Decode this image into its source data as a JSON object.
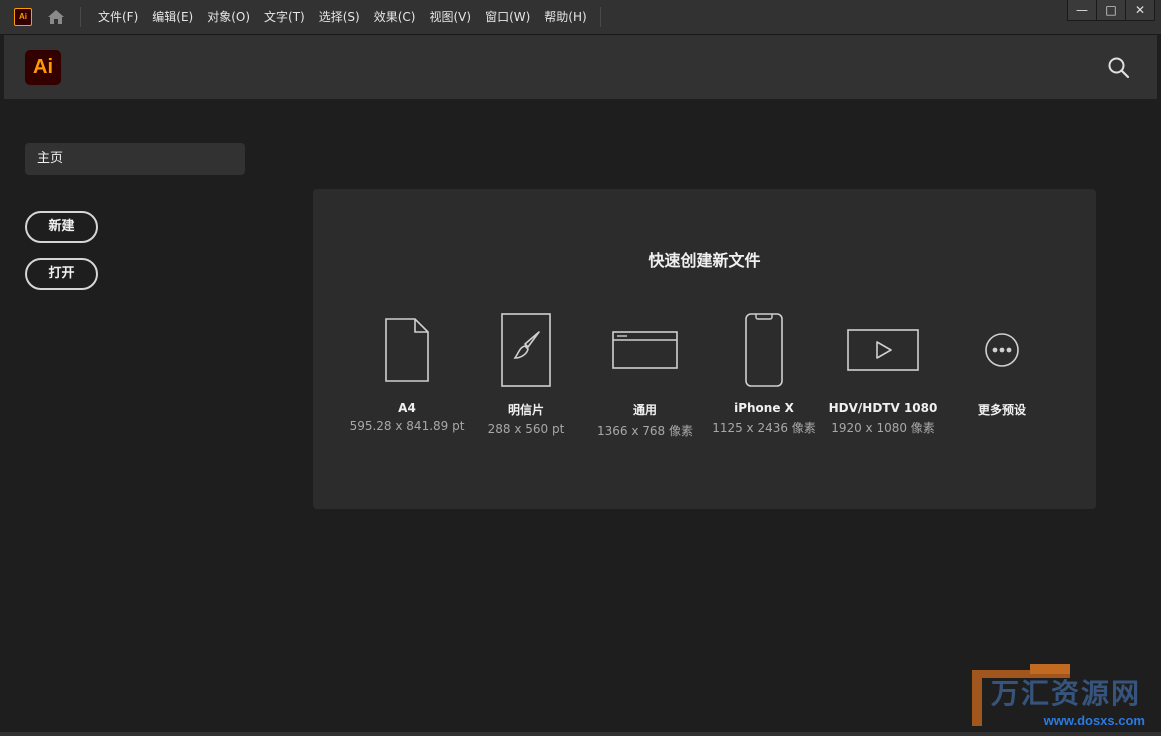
{
  "menubar": {
    "app_badge": "Ai",
    "items": [
      "文件(F)",
      "编辑(E)",
      "对象(O)",
      "文字(T)",
      "选择(S)",
      "效果(C)",
      "视图(V)",
      "窗口(W)",
      "帮助(H)"
    ],
    "window_controls": {
      "minimize": "—",
      "maximize": "□",
      "close": "✕"
    }
  },
  "header": {
    "logo": "Ai"
  },
  "sidebar": {
    "home": "主页",
    "new_button": "新建",
    "open_button": "打开"
  },
  "quick_create": {
    "title": "快速创建新文件",
    "presets": [
      {
        "name": "A4",
        "size": "595.28 x 841.89 pt",
        "icon": "document-icon"
      },
      {
        "name": "明信片",
        "size": "288 x 560 pt",
        "icon": "brush-card-icon"
      },
      {
        "name": "通用",
        "size": "1366 x 768 像素",
        "icon": "browser-window-icon"
      },
      {
        "name": "iPhone X",
        "size": "1125 x 2436 像素",
        "icon": "phone-icon"
      },
      {
        "name": "HDV/HDTV 1080",
        "size": "1920 x 1080 像素",
        "icon": "video-icon"
      },
      {
        "name": "更多预设",
        "size": "",
        "icon": "more-icon"
      }
    ]
  },
  "watermark": {
    "text_cn": "万汇资源网",
    "url": "www.dosxs.com"
  },
  "colors": {
    "accent": "#ff9a00",
    "logo_bg": "#330000",
    "bg": "#1e1e1e",
    "panel": "#2c2c2c",
    "bar": "#323232"
  }
}
